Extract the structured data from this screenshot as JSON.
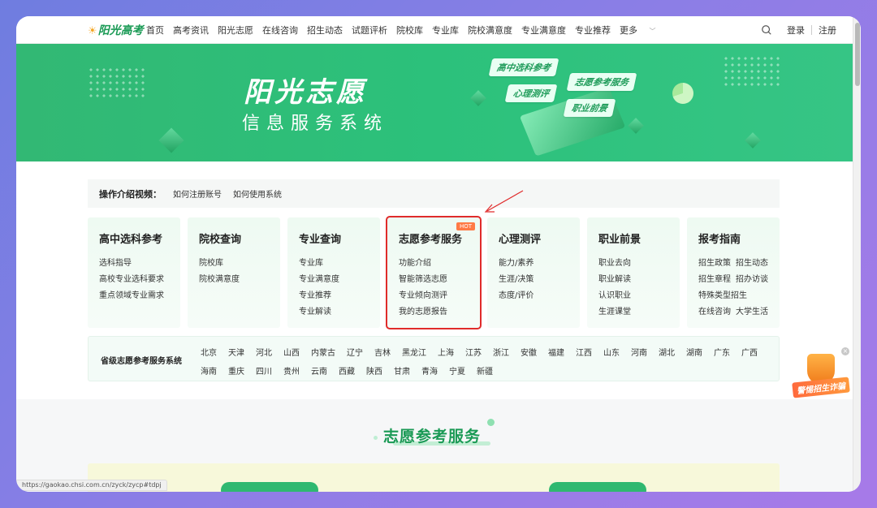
{
  "nav": {
    "logo": "阳光高考",
    "menu": [
      "首页",
      "高考资讯",
      "阳光志愿",
      "在线咨询",
      "招生动态",
      "试题评析",
      "院校库",
      "专业库",
      "院校满意度",
      "专业满意度",
      "专业推荐",
      "更多"
    ],
    "login": "登录",
    "register": "注册"
  },
  "banner": {
    "title": "阳光志愿",
    "subtitle": "信息服务系统",
    "tags": [
      "高中选科参考",
      "心理测评",
      "志愿参考服务",
      "职业前景"
    ]
  },
  "intro": {
    "label": "操作介绍视频：",
    "links": [
      "如何注册账号",
      "如何使用系统"
    ]
  },
  "cards": [
    {
      "title": "高中选科参考",
      "items": [
        "选科指导",
        "高校专业选科要求",
        "重点领域专业需求"
      ]
    },
    {
      "title": "院校查询",
      "items": [
        "院校库",
        "院校满意度"
      ]
    },
    {
      "title": "专业查询",
      "items": [
        "专业库",
        "专业满意度",
        "专业推荐",
        "专业解读"
      ]
    },
    {
      "title": "志愿参考服务",
      "badge": "HOT",
      "items": [
        "功能介绍",
        "智能筛选志愿",
        "专业倾向测评",
        "我的志愿报告"
      ]
    },
    {
      "title": "心理测评",
      "items": [
        "能力/素养",
        "生涯/决策",
        "态度/评价"
      ]
    },
    {
      "title": "职业前景",
      "items": [
        "职业去向",
        "职业解读",
        "认识职业",
        "生涯课堂"
      ]
    },
    {
      "title": "报考指南",
      "items": [
        "招生政策",
        "招生动态",
        "招生章程",
        "招办访谈",
        "特殊类型招生",
        "在线咨询",
        "大学生活"
      ]
    }
  ],
  "provinces": {
    "label": "省级志愿参考服务系统",
    "list": [
      "北京",
      "天津",
      "河北",
      "山西",
      "内蒙古",
      "辽宁",
      "吉林",
      "黑龙江",
      "上海",
      "江苏",
      "浙江",
      "安徽",
      "福建",
      "江西",
      "山东",
      "河南",
      "湖北",
      "湖南",
      "广东",
      "广西",
      "海南",
      "重庆",
      "四川",
      "贵州",
      "云南",
      "西藏",
      "陕西",
      "甘肃",
      "青海",
      "宁夏",
      "新疆"
    ]
  },
  "section": {
    "title": "志愿参考服务"
  },
  "status_url": "https://gaokao.chsi.com.cn/zyck/zycp#tdpj",
  "promo": {
    "text": "警惕招生诈骗"
  },
  "colors": {
    "brand": "#2cc17b",
    "highlight": "#e02b2b",
    "hot": "#ff7a45"
  }
}
